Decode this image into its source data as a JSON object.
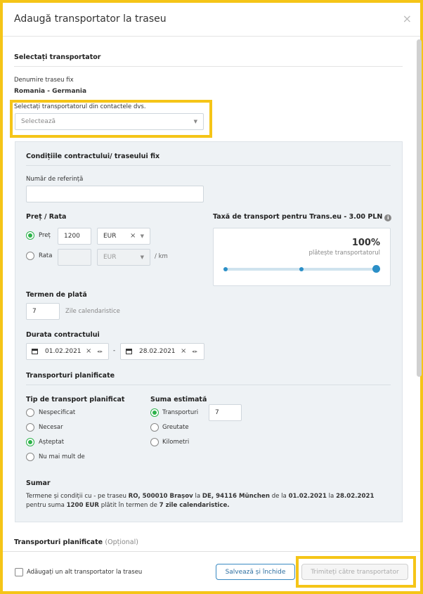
{
  "dialog": {
    "title": "Adaugă transportator la traseu",
    "close_label": "×"
  },
  "select_carrier": {
    "section_title": "Selectați transportator",
    "route_label": "Denumire traseu fix",
    "route_value": "Romania - Germania",
    "contacts_label": "Selectați transportatorul din contactele dvs.",
    "contacts_placeholder": "Selectează"
  },
  "contract": {
    "section_title": "Condițiile contractului/ traseului fix",
    "reference_label": "Număr de referință",
    "reference_value": "",
    "price_title": "Preț / Rata",
    "price_option_label": "Preț",
    "price_value": "1200",
    "price_currency": "EUR",
    "rate_option_label": "Rata",
    "rate_value": "",
    "rate_currency": "EUR",
    "rate_unit": "/ km",
    "fee_title": "Taxă de transport pentru Trans.eu - 3.00 PLN",
    "fee_percent": "100%",
    "fee_payer": "plătește transportatorul",
    "fee_share": 1.0,
    "payment_term_title": "Termen de plată",
    "payment_term_value": "7",
    "payment_term_unit": "Zile calendaristice",
    "duration_title": "Durata contractului",
    "date_from": "01.02.2021",
    "date_to": "28.02.2021",
    "date_separator": "-",
    "planned_title": "Transporturi planificate",
    "planned_type_title": "Tip de transport planificat",
    "planned_types": [
      {
        "label": "Nespecificat",
        "selected": false
      },
      {
        "label": "Necesar",
        "selected": false
      },
      {
        "label": "Așteptat",
        "selected": true
      },
      {
        "label": "Nu mai mult de",
        "selected": false
      }
    ],
    "estimated_title": "Suma estimată",
    "estimated_options": [
      {
        "label": "Transporturi",
        "selected": true
      },
      {
        "label": "Greutate",
        "selected": false
      },
      {
        "label": "Kilometri",
        "selected": false
      }
    ],
    "estimated_value": "7",
    "summary_title": "Sumar",
    "summary": {
      "p1": "Termene și condiții cu - pe traseu ",
      "b1": "RO, 500010 Brașov",
      "p2": " la ",
      "b2": "DE, 94116 München",
      "p3": " de la ",
      "b3": "01.02.2021",
      "p4": " la ",
      "b4": "28.02.2021",
      "p5": "pentru suma ",
      "b5": "1200 EUR",
      "p6": " plătit în termen de ",
      "b6": "7 zile calendaristice."
    }
  },
  "planned_optional": {
    "title": "Transporturi planificate",
    "suffix": "(Opțional)"
  },
  "footer": {
    "add_another_label": "Adăugați un alt transportator la traseu",
    "save_close_label": "Salvează și închide",
    "send_label": "Trimiteți către transportator"
  },
  "colors": {
    "highlight": "#f5c518",
    "accent_green": "#2cb24a",
    "accent_blue": "#2b8fc7"
  }
}
